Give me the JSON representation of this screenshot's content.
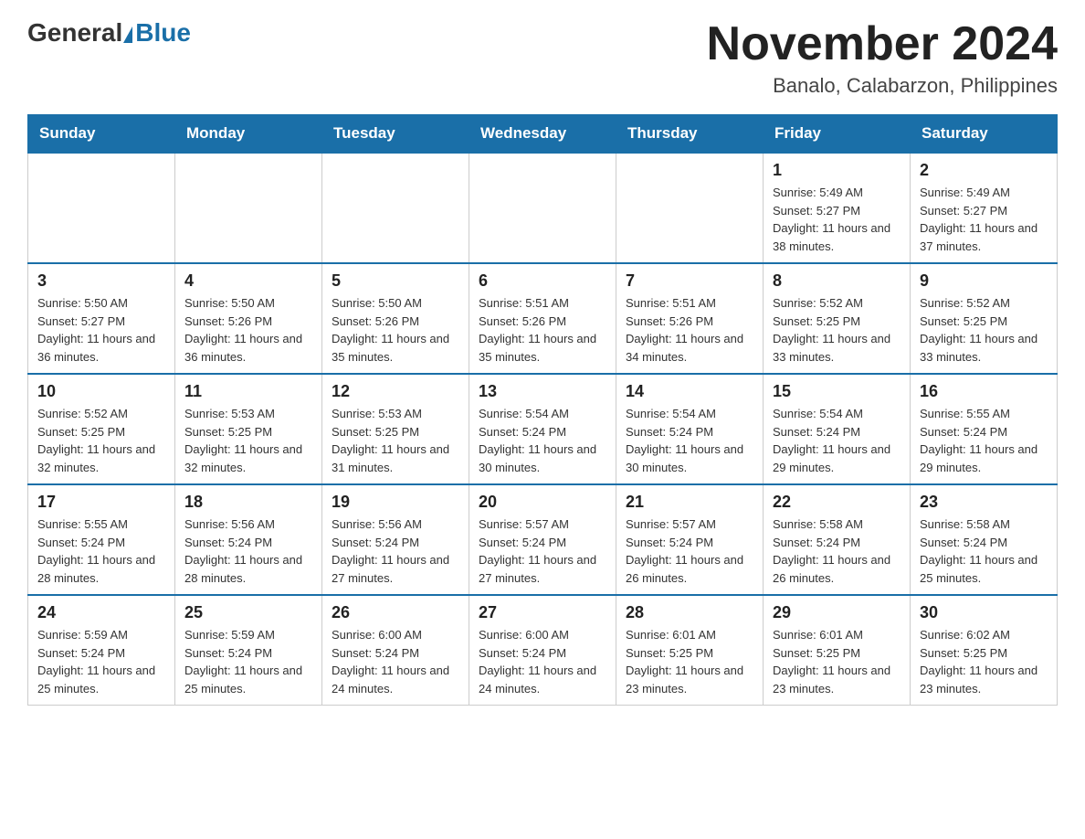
{
  "header": {
    "logo_general": "General",
    "logo_blue": "Blue",
    "title": "November 2024",
    "subtitle": "Banalo, Calabarzon, Philippines"
  },
  "days_of_week": [
    "Sunday",
    "Monday",
    "Tuesday",
    "Wednesday",
    "Thursday",
    "Friday",
    "Saturday"
  ],
  "weeks": [
    [
      {
        "day": "",
        "sunrise": "",
        "sunset": "",
        "daylight": ""
      },
      {
        "day": "",
        "sunrise": "",
        "sunset": "",
        "daylight": ""
      },
      {
        "day": "",
        "sunrise": "",
        "sunset": "",
        "daylight": ""
      },
      {
        "day": "",
        "sunrise": "",
        "sunset": "",
        "daylight": ""
      },
      {
        "day": "",
        "sunrise": "",
        "sunset": "",
        "daylight": ""
      },
      {
        "day": "1",
        "sunrise": "Sunrise: 5:49 AM",
        "sunset": "Sunset: 5:27 PM",
        "daylight": "Daylight: 11 hours and 38 minutes."
      },
      {
        "day": "2",
        "sunrise": "Sunrise: 5:49 AM",
        "sunset": "Sunset: 5:27 PM",
        "daylight": "Daylight: 11 hours and 37 minutes."
      }
    ],
    [
      {
        "day": "3",
        "sunrise": "Sunrise: 5:50 AM",
        "sunset": "Sunset: 5:27 PM",
        "daylight": "Daylight: 11 hours and 36 minutes."
      },
      {
        "day": "4",
        "sunrise": "Sunrise: 5:50 AM",
        "sunset": "Sunset: 5:26 PM",
        "daylight": "Daylight: 11 hours and 36 minutes."
      },
      {
        "day": "5",
        "sunrise": "Sunrise: 5:50 AM",
        "sunset": "Sunset: 5:26 PM",
        "daylight": "Daylight: 11 hours and 35 minutes."
      },
      {
        "day": "6",
        "sunrise": "Sunrise: 5:51 AM",
        "sunset": "Sunset: 5:26 PM",
        "daylight": "Daylight: 11 hours and 35 minutes."
      },
      {
        "day": "7",
        "sunrise": "Sunrise: 5:51 AM",
        "sunset": "Sunset: 5:26 PM",
        "daylight": "Daylight: 11 hours and 34 minutes."
      },
      {
        "day": "8",
        "sunrise": "Sunrise: 5:52 AM",
        "sunset": "Sunset: 5:25 PM",
        "daylight": "Daylight: 11 hours and 33 minutes."
      },
      {
        "day": "9",
        "sunrise": "Sunrise: 5:52 AM",
        "sunset": "Sunset: 5:25 PM",
        "daylight": "Daylight: 11 hours and 33 minutes."
      }
    ],
    [
      {
        "day": "10",
        "sunrise": "Sunrise: 5:52 AM",
        "sunset": "Sunset: 5:25 PM",
        "daylight": "Daylight: 11 hours and 32 minutes."
      },
      {
        "day": "11",
        "sunrise": "Sunrise: 5:53 AM",
        "sunset": "Sunset: 5:25 PM",
        "daylight": "Daylight: 11 hours and 32 minutes."
      },
      {
        "day": "12",
        "sunrise": "Sunrise: 5:53 AM",
        "sunset": "Sunset: 5:25 PM",
        "daylight": "Daylight: 11 hours and 31 minutes."
      },
      {
        "day": "13",
        "sunrise": "Sunrise: 5:54 AM",
        "sunset": "Sunset: 5:24 PM",
        "daylight": "Daylight: 11 hours and 30 minutes."
      },
      {
        "day": "14",
        "sunrise": "Sunrise: 5:54 AM",
        "sunset": "Sunset: 5:24 PM",
        "daylight": "Daylight: 11 hours and 30 minutes."
      },
      {
        "day": "15",
        "sunrise": "Sunrise: 5:54 AM",
        "sunset": "Sunset: 5:24 PM",
        "daylight": "Daylight: 11 hours and 29 minutes."
      },
      {
        "day": "16",
        "sunrise": "Sunrise: 5:55 AM",
        "sunset": "Sunset: 5:24 PM",
        "daylight": "Daylight: 11 hours and 29 minutes."
      }
    ],
    [
      {
        "day": "17",
        "sunrise": "Sunrise: 5:55 AM",
        "sunset": "Sunset: 5:24 PM",
        "daylight": "Daylight: 11 hours and 28 minutes."
      },
      {
        "day": "18",
        "sunrise": "Sunrise: 5:56 AM",
        "sunset": "Sunset: 5:24 PM",
        "daylight": "Daylight: 11 hours and 28 minutes."
      },
      {
        "day": "19",
        "sunrise": "Sunrise: 5:56 AM",
        "sunset": "Sunset: 5:24 PM",
        "daylight": "Daylight: 11 hours and 27 minutes."
      },
      {
        "day": "20",
        "sunrise": "Sunrise: 5:57 AM",
        "sunset": "Sunset: 5:24 PM",
        "daylight": "Daylight: 11 hours and 27 minutes."
      },
      {
        "day": "21",
        "sunrise": "Sunrise: 5:57 AM",
        "sunset": "Sunset: 5:24 PM",
        "daylight": "Daylight: 11 hours and 26 minutes."
      },
      {
        "day": "22",
        "sunrise": "Sunrise: 5:58 AM",
        "sunset": "Sunset: 5:24 PM",
        "daylight": "Daylight: 11 hours and 26 minutes."
      },
      {
        "day": "23",
        "sunrise": "Sunrise: 5:58 AM",
        "sunset": "Sunset: 5:24 PM",
        "daylight": "Daylight: 11 hours and 25 minutes."
      }
    ],
    [
      {
        "day": "24",
        "sunrise": "Sunrise: 5:59 AM",
        "sunset": "Sunset: 5:24 PM",
        "daylight": "Daylight: 11 hours and 25 minutes."
      },
      {
        "day": "25",
        "sunrise": "Sunrise: 5:59 AM",
        "sunset": "Sunset: 5:24 PM",
        "daylight": "Daylight: 11 hours and 25 minutes."
      },
      {
        "day": "26",
        "sunrise": "Sunrise: 6:00 AM",
        "sunset": "Sunset: 5:24 PM",
        "daylight": "Daylight: 11 hours and 24 minutes."
      },
      {
        "day": "27",
        "sunrise": "Sunrise: 6:00 AM",
        "sunset": "Sunset: 5:24 PM",
        "daylight": "Daylight: 11 hours and 24 minutes."
      },
      {
        "day": "28",
        "sunrise": "Sunrise: 6:01 AM",
        "sunset": "Sunset: 5:25 PM",
        "daylight": "Daylight: 11 hours and 23 minutes."
      },
      {
        "day": "29",
        "sunrise": "Sunrise: 6:01 AM",
        "sunset": "Sunset: 5:25 PM",
        "daylight": "Daylight: 11 hours and 23 minutes."
      },
      {
        "day": "30",
        "sunrise": "Sunrise: 6:02 AM",
        "sunset": "Sunset: 5:25 PM",
        "daylight": "Daylight: 11 hours and 23 minutes."
      }
    ]
  ]
}
